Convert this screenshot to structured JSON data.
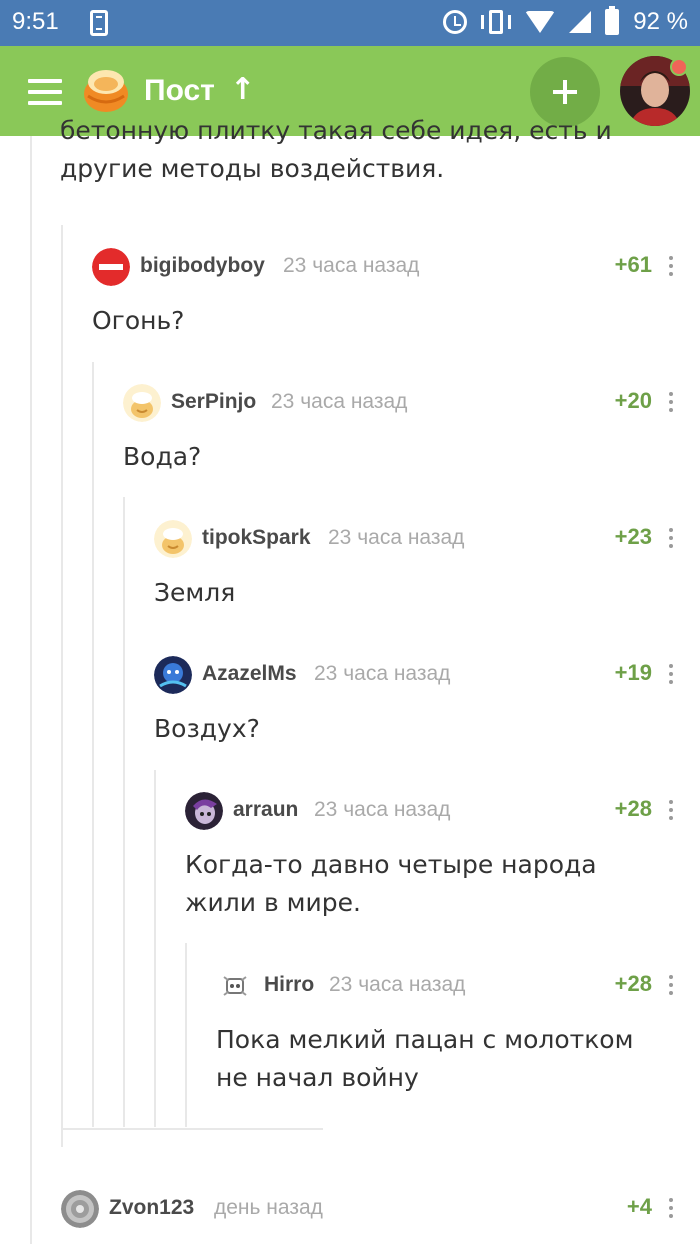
{
  "status_bar": {
    "time": "9:51",
    "battery": "92 %",
    "icons": [
      "phone-icon",
      "alarm-icon",
      "vibrate-icon",
      "wifi-icon",
      "signal-icon",
      "battery-icon"
    ]
  },
  "app_bar": {
    "title": "Пост",
    "arrow": "↑",
    "icons": [
      "menu-icon",
      "logo-icon",
      "add-icon",
      "avatar"
    ],
    "background": "#8ac858"
  },
  "post_tail": {
    "line1": "бетонную плитку такая себе идея, есть и",
    "line2": "другие методы воздействия."
  },
  "comments": [
    {
      "author": "bigibodyboy",
      "time": "23 часа назад",
      "rating": "+61",
      "text": [
        "Огонь?"
      ]
    },
    {
      "author": "SerPinjo",
      "time": "23 часа назад",
      "rating": "+20",
      "text": [
        "Вода?"
      ]
    },
    {
      "author": "tipokSpark",
      "time": "23 часа назад",
      "rating": "+23",
      "text": [
        "Земля"
      ]
    },
    {
      "author": "AzazelMs",
      "time": "23 часа назад",
      "rating": "+19",
      "text": [
        "Воздух?"
      ]
    },
    {
      "author": "arraun",
      "time": "23 часа назад",
      "rating": "+28",
      "text": [
        "Когда-то давно четыре народа",
        "жили в мире."
      ]
    },
    {
      "author": "Hirro",
      "time": "23 часа назад",
      "rating": "+28",
      "text": [
        "Пока мелкий пацан с молотком",
        "не начал войну"
      ]
    },
    {
      "author": "Zvon123",
      "time": "день назад",
      "rating": "+4",
      "text": []
    }
  ],
  "colors": {
    "status_bar": "#4a7bb4",
    "rating": "#6ea048",
    "time": "#a9a9a9"
  }
}
